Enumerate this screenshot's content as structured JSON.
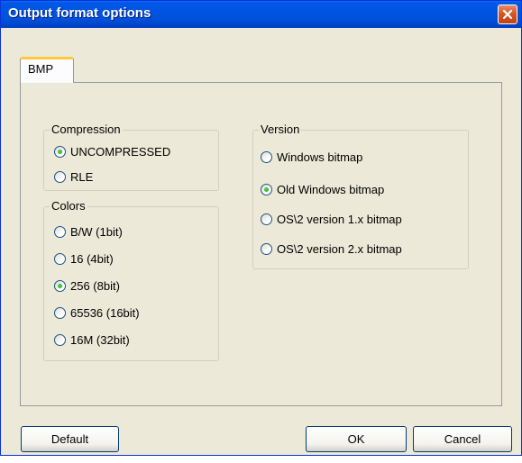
{
  "window": {
    "title": "Output format options"
  },
  "tabs": [
    {
      "label": "BMP",
      "selected": true
    }
  ],
  "compression": {
    "legend": "Compression",
    "options": [
      {
        "label": "UNCOMPRESSED",
        "checked": true
      },
      {
        "label": "RLE",
        "checked": false
      }
    ]
  },
  "colors": {
    "legend": "Colors",
    "options": [
      {
        "label": "B/W (1bit)",
        "checked": false
      },
      {
        "label": "16 (4bit)",
        "checked": false
      },
      {
        "label": "256 (8bit)",
        "checked": true
      },
      {
        "label": "65536 (16bit)",
        "checked": false
      },
      {
        "label": "16M (32bit)",
        "checked": false
      }
    ]
  },
  "version": {
    "legend": "Version",
    "options": [
      {
        "label": "Windows bitmap",
        "checked": false
      },
      {
        "label": "Old Windows bitmap",
        "checked": true
      },
      {
        "label": "OS\\2 version 1.x bitmap",
        "checked": false
      },
      {
        "label": "OS\\2 version 2.x bitmap",
        "checked": false
      }
    ]
  },
  "buttons": {
    "default": "Default",
    "ok": "OK",
    "cancel": "Cancel"
  }
}
